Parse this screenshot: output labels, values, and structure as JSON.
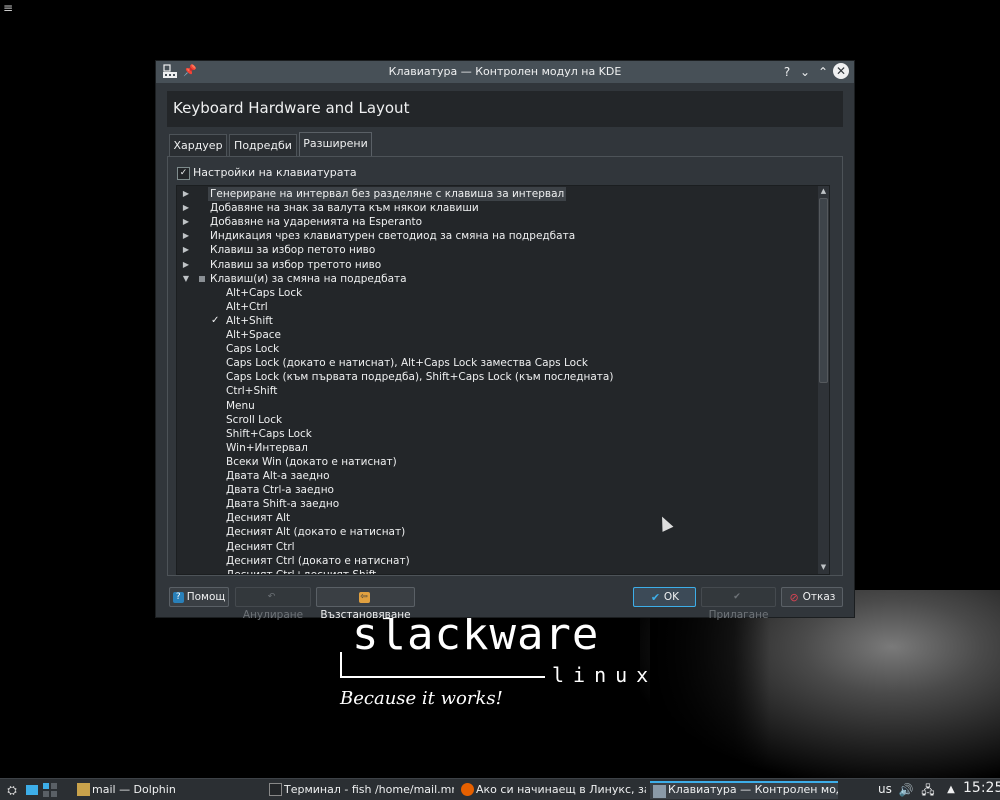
{
  "desktop": {
    "menu_glyph": "≡",
    "logo_text": "slackware",
    "logo_sub": "linux",
    "logo_tagline": "Because it works!"
  },
  "dialog": {
    "title": "Клавиатура — Контролен модул на KDE",
    "title_buttons": {
      "help": "?",
      "minimize": "⌄",
      "maximize": "⌃",
      "close": "✕"
    },
    "header": "Keyboard Hardware and Layout",
    "tabs": [
      {
        "label": "Хардуер"
      },
      {
        "label": "Подредби"
      },
      {
        "label": "Разширени"
      }
    ],
    "keyboard_settings_label": "Настройки на клавиатурата",
    "keyboard_settings_checked": true,
    "tree": {
      "groups": [
        {
          "label": "Генериране на интервал без разделяне с клавиша за интервал",
          "expanded": false,
          "selected": true
        },
        {
          "label": "Добавяне на знак за валута към някои клавиши",
          "expanded": false
        },
        {
          "label": "Добавяне на ударенията на Esperanto",
          "expanded": false
        },
        {
          "label": "Индикация чрез клавиатурен светодиод за смяна на подредбата",
          "expanded": false
        },
        {
          "label": "Клавиш за избор петото ниво",
          "expanded": false
        },
        {
          "label": "Клавиш за избор третото ниво",
          "expanded": false
        },
        {
          "label": "Клавиш(и) за смяна на подредбата",
          "expanded": true
        }
      ],
      "options": [
        {
          "label": "Alt+Caps Lock",
          "checked": false
        },
        {
          "label": "Alt+Ctrl",
          "checked": false
        },
        {
          "label": "Alt+Shift",
          "checked": true
        },
        {
          "label": "Alt+Space",
          "checked": false
        },
        {
          "label": "Caps Lock",
          "checked": false
        },
        {
          "label": "Caps Lock (докато е натиснат), Alt+Caps Lock замества Caps Lock",
          "checked": false
        },
        {
          "label": "Caps Lock (към първата подредба), Shift+Caps Lock (към последната)",
          "checked": false
        },
        {
          "label": "Ctrl+Shift",
          "checked": false
        },
        {
          "label": "Menu",
          "checked": false
        },
        {
          "label": "Scroll Lock",
          "checked": false
        },
        {
          "label": "Shift+Caps Lock",
          "checked": false
        },
        {
          "label": "Win+Интервал",
          "checked": false
        },
        {
          "label": "Всеки Win (докато е натиснат)",
          "checked": false
        },
        {
          "label": "Двата Alt-а заедно",
          "checked": false
        },
        {
          "label": "Двата Ctrl-а заедно",
          "checked": false
        },
        {
          "label": "Двата Shift-а заедно",
          "checked": false
        },
        {
          "label": "Десният Alt",
          "checked": false
        },
        {
          "label": "Десният Alt (докато е натиснат)",
          "checked": false
        },
        {
          "label": "Десният Ctrl",
          "checked": false
        },
        {
          "label": "Десният Ctrl (докато е натиснат)",
          "checked": false
        },
        {
          "label": "Десният Ctrl+десният Shift",
          "checked": false
        }
      ],
      "checked_mark": "✓",
      "arrow_collapsed": "▶",
      "arrow_expanded": "▼"
    },
    "buttons": {
      "help": "Помощ",
      "undo": "Анулиране",
      "defaults": "Възстановяване",
      "ok": "OK",
      "apply": "Прилагане",
      "cancel": "Отказ"
    }
  },
  "taskbar": {
    "tasks": [
      {
        "label": "mail — Dolphin"
      },
      {
        "label": "Терминал - fish  /home/mail.mrejata"
      },
      {
        "label": "Ако си начинаещ в Линукс, задай въ"
      },
      {
        "label": "Клавиатура — Контролен модул на"
      }
    ],
    "keyboard_layout": "us",
    "clock": "15:25"
  },
  "colors": {
    "accent": "#3daee9",
    "dialog_bg": "#31363b",
    "view_bg": "#232629",
    "titlebar": "#475057"
  }
}
